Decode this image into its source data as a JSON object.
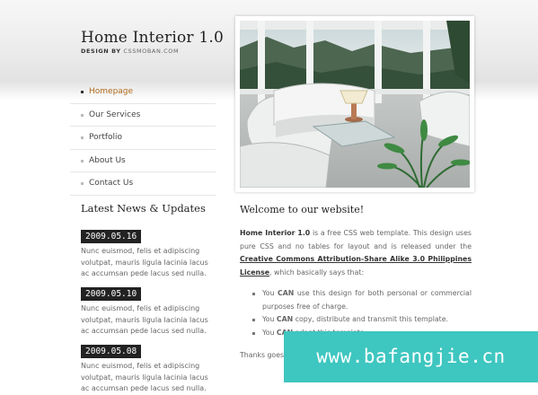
{
  "header": {
    "title": "Home Interior 1.0",
    "designed_by_label": "DESIGN BY",
    "designed_by_value": "CSSMOBAN.COM"
  },
  "nav": {
    "items": [
      {
        "label": "Homepage",
        "active": true
      },
      {
        "label": "Our Services",
        "active": false
      },
      {
        "label": "Portfolio",
        "active": false
      },
      {
        "label": "About Us",
        "active": false
      },
      {
        "label": "Contact Us",
        "active": false
      }
    ]
  },
  "news": {
    "heading": "Latest News & Updates",
    "items": [
      {
        "date": "2009.05.16",
        "text": "Nunc euismod, felis et adipiscing volutpat, mauris ligula lacinia lacus ac accumsan pede lacus sed nulla."
      },
      {
        "date": "2009.05.10",
        "text": "Nunc euismod, felis et adipiscing volutpat, mauris ligula lacinia lacus ac accumsan pede lacus sed nulla."
      },
      {
        "date": "2009.05.08",
        "text": "Nunc euismod, felis et adipiscing volutpat, mauris ligula lacinia lacus ac accumsan pede lacus sed nulla."
      }
    ]
  },
  "main": {
    "heading": "Welcome to our website!",
    "intro_name": "Home Interior 1.0",
    "intro_text_1": " is a free CSS web template. This design uses pure CSS and no tables for layout and is released under the ",
    "license_link": "Creative Commons Attribution-Share Alike 3.0 Philippines License",
    "intro_text_2": ", which basically says that:",
    "bullets": [
      {
        "pre": "You ",
        "strong": "CAN",
        "post": " use this design for both personal or commercial purposes free of charge."
      },
      {
        "pre": "You ",
        "strong": "CAN",
        "post": " copy, distribute and transmit this template."
      },
      {
        "pre": "You ",
        "strong": "CAN",
        "post": " adapt this template."
      }
    ],
    "thanks": "Thanks goes to the designers of this template."
  },
  "watermark": {
    "text": "www.bafangjie.cn"
  },
  "colors": {
    "active_nav": "#b06a1c",
    "date_badge_bg": "#222222",
    "watermark_bg": "#3ec6c0"
  }
}
